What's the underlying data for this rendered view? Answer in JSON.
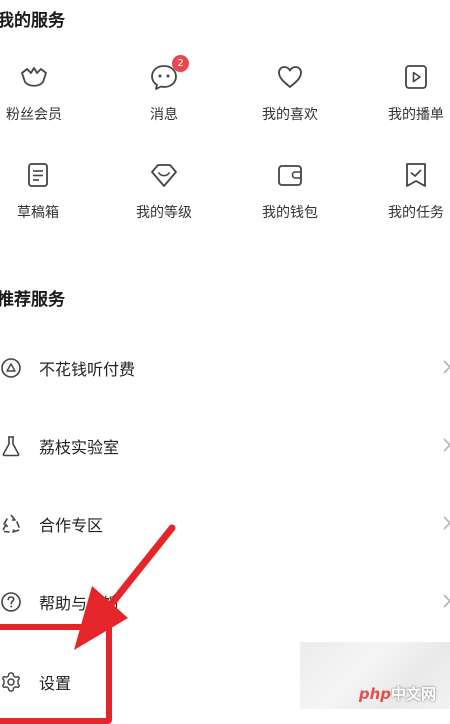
{
  "my_services": {
    "title": "我的服务",
    "items": [
      {
        "label": "粉丝会员",
        "icon": "crown-icon"
      },
      {
        "label": "消息",
        "icon": "chat-bubble-icon",
        "badge": "2"
      },
      {
        "label": "我的喜欢",
        "icon": "heart-icon"
      },
      {
        "label": "我的播单",
        "icon": "playlist-icon"
      },
      {
        "label": "草稿箱",
        "icon": "draft-document-icon"
      },
      {
        "label": "我的等级",
        "icon": "level-icon"
      },
      {
        "label": "我的钱包",
        "icon": "wallet-icon"
      },
      {
        "label": "我的任务",
        "icon": "task-icon"
      }
    ]
  },
  "recommended": {
    "title": "推荐服务",
    "items": [
      {
        "label": "不花钱听付费",
        "icon": "free-listen-icon"
      },
      {
        "label": "荔枝实验室",
        "icon": "flask-icon"
      },
      {
        "label": "合作专区",
        "icon": "cooperation-icon"
      },
      {
        "label": "帮助与反馈",
        "icon": "help-icon"
      },
      {
        "label": "设置",
        "icon": "settings-gear-icon"
      }
    ]
  },
  "colors": {
    "badge": "#e8474d",
    "annotation_red": "#e4262b"
  },
  "watermark": {
    "php": "php",
    "text": "中文网"
  }
}
